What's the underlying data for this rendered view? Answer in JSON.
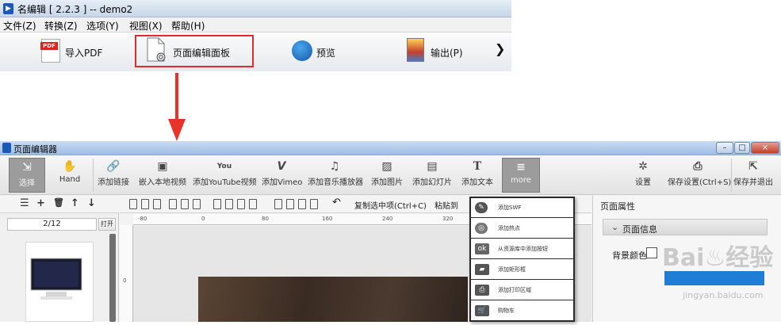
{
  "top_window": {
    "title": "名编辑 [ 2.2.3 ] -- demo2",
    "menu": [
      "文件(Z)",
      "转换(Z)",
      "选项(Y)",
      "视图(X)",
      "帮助(H)"
    ],
    "toolbar": {
      "import_pdf": "导入PDF",
      "page_editor_panel": "页面编辑面板",
      "preview": "预览",
      "export": "输出(P)",
      "more_arrow": "❯"
    },
    "pdf_icon_text": "PDF"
  },
  "editor_window": {
    "title": "页面编辑器",
    "window_controls": [
      "–",
      "□",
      "×"
    ],
    "toolbar": [
      {
        "icon": "⇲",
        "label": "选择"
      },
      {
        "icon": "✋",
        "label": "Hand"
      },
      {
        "icon": "🔗",
        "label": "添加链接"
      },
      {
        "icon": "▣",
        "label": "嵌入本地视频"
      },
      {
        "icon": "You",
        "label": "添加YouTube视频"
      },
      {
        "icon": "V",
        "label": "添加Vimeo"
      },
      {
        "icon": "♫",
        "label": "添加音乐播放器"
      },
      {
        "icon": "▨",
        "label": "添加图片"
      },
      {
        "icon": "▤",
        "label": "添加幻灯片"
      },
      {
        "icon": "T",
        "label": "添加文本"
      },
      {
        "icon": "≡",
        "label": "more"
      }
    ],
    "right_toolbar": [
      {
        "icon": "✲",
        "label": "设置"
      },
      {
        "icon": "⎙",
        "label": "保存设置(Ctrl+S)"
      },
      {
        "icon": "⇱",
        "label": "保存并退出"
      }
    ],
    "left_panel": {
      "actions": [
        "☰",
        "+",
        "🗑",
        "↑",
        "↓"
      ],
      "page_input_value": "2/12",
      "open_button": "打开"
    },
    "align_toolbar": {
      "copy_selected": "复制选中项(Ctrl+C)",
      "paste": "粘贴到"
    },
    "ruler": {
      "top_ticks": [
        "-80",
        "0",
        "80",
        "160",
        "240",
        "320"
      ],
      "left_ticks": [
        "0"
      ]
    },
    "properties": {
      "title": "页面属性",
      "section": "页面信息",
      "bg_color_label": "背景颜色"
    },
    "more_menu": [
      {
        "icon": "✎",
        "label": "添加SWF"
      },
      {
        "icon": "◎",
        "label": "添加热点"
      },
      {
        "icon": "ok",
        "label": "从资源库中添加按钮"
      },
      {
        "icon": "▰",
        "label": "添加矩形框"
      },
      {
        "icon": "⎙",
        "label": "添加打印区域"
      },
      {
        "icon": "🛒",
        "label": "购物车"
      }
    ]
  },
  "watermark": {
    "text": "Bai♨经验",
    "url": "jingyan.baidu.com"
  },
  "colors": {
    "highlight": "#e02c2c",
    "arrow": "#e8332b",
    "accent_blue": "#1e7ed6"
  }
}
